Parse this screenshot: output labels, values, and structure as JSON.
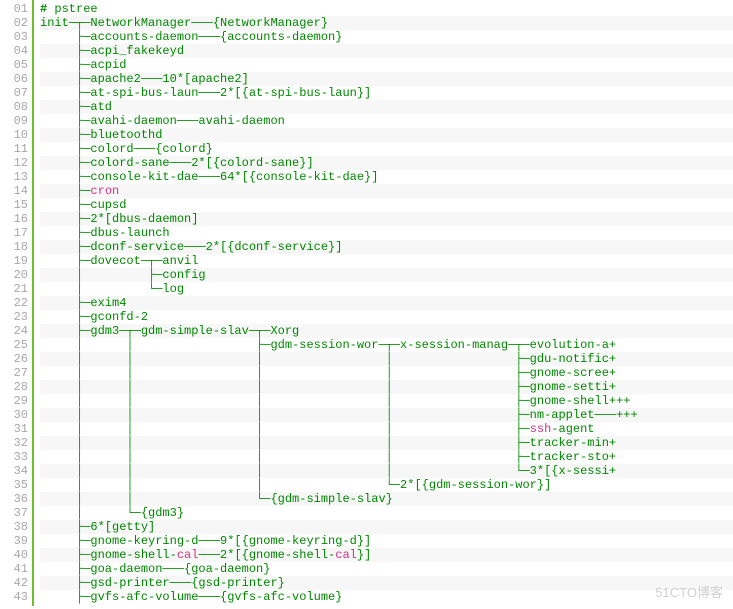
{
  "watermark": "51CTO博客",
  "lines": [
    {
      "n": "01",
      "t": "<span class='prompt'>#</span> pstree"
    },
    {
      "n": "02",
      "t": "init─┬─NetworkManager───{NetworkManager}"
    },
    {
      "n": "03",
      "t": "     ├─accounts-daemon───{accounts-daemon}"
    },
    {
      "n": "04",
      "t": "     ├─acpi_fakekeyd"
    },
    {
      "n": "05",
      "t": "     ├─acpid"
    },
    {
      "n": "06",
      "t": "     ├─apache2───10*[apache2]"
    },
    {
      "n": "07",
      "t": "     ├─at-spi-bus-laun───2*[{at-spi-bus-laun}]"
    },
    {
      "n": "08",
      "t": "     ├─atd"
    },
    {
      "n": "09",
      "t": "     ├─avahi-daemon───avahi-daemon"
    },
    {
      "n": "10",
      "t": "     ├─bluetoothd"
    },
    {
      "n": "11",
      "t": "     ├─colord───{colord}"
    },
    {
      "n": "12",
      "t": "     ├─colord-sane───2*[{colord-sane}]"
    },
    {
      "n": "13",
      "t": "     ├─console-kit-dae───64*[{console-kit-dae}]"
    },
    {
      "n": "14",
      "t": "     ├─<span class='hl'>cron</span>"
    },
    {
      "n": "15",
      "t": "     ├─cupsd"
    },
    {
      "n": "16",
      "t": "     ├─2*[dbus-daemon]"
    },
    {
      "n": "17",
      "t": "     ├─dbus-launch"
    },
    {
      "n": "18",
      "t": "     ├─dconf-service───2*[{dconf-service}]"
    },
    {
      "n": "19",
      "t": "     ├─dovecot─┬─anvil"
    },
    {
      "n": "20",
      "t": "     │         ├─config"
    },
    {
      "n": "21",
      "t": "     │         └─log"
    },
    {
      "n": "22",
      "t": "     ├─exim4"
    },
    {
      "n": "23",
      "t": "     ├─gconfd-2"
    },
    {
      "n": "24",
      "t": "     ├─gdm3─┬─gdm-simple-slav─┬─Xorg"
    },
    {
      "n": "25",
      "t": "     │      │                 ├─gdm-session-wor─┬─x-session-manag─┬─evolution-a+"
    },
    {
      "n": "26",
      "t": "     │      │                 │                 │                 ├─gdu-notific+"
    },
    {
      "n": "27",
      "t": "     │      │                 │                 │                 ├─gnome-scree+"
    },
    {
      "n": "28",
      "t": "     │      │                 │                 │                 ├─gnome-setti+"
    },
    {
      "n": "29",
      "t": "     │      │                 │                 │                 ├─gnome-shell+++"
    },
    {
      "n": "30",
      "t": "     │      │                 │                 │                 ├─nm-applet───+++"
    },
    {
      "n": "31",
      "t": "     │      │                 │                 │                 ├─<span class='hl'>ssh</span>-agent"
    },
    {
      "n": "32",
      "t": "     │      │                 │                 │                 ├─tracker-min+"
    },
    {
      "n": "33",
      "t": "     │      │                 │                 │                 ├─tracker-sto+"
    },
    {
      "n": "34",
      "t": "     │      │                 │                 │                 └─3*[{x-sessi+"
    },
    {
      "n": "35",
      "t": "     │      │                 │                 └─2*[{gdm-session-wor}]"
    },
    {
      "n": "36",
      "t": "     │      │                 └─{gdm-simple-slav}"
    },
    {
      "n": "37",
      "t": "     │      └─{gdm3}"
    },
    {
      "n": "38",
      "t": "     ├─6*[getty]"
    },
    {
      "n": "39",
      "t": "     ├─gnome-keyring-d───9*[{gnome-keyring-d}]"
    },
    {
      "n": "40",
      "t": "     ├─gnome-shell-<span class='hl'>cal</span>───2*[{gnome-shell-<span class='hl'>cal</span>}]"
    },
    {
      "n": "41",
      "t": "     ├─goa-daemon───{goa-daemon}"
    },
    {
      "n": "42",
      "t": "     ├─gsd-printer───{gsd-printer}"
    },
    {
      "n": "43",
      "t": "     ├─gvfs-afc-volume───{gvfs-afc-volume}"
    }
  ]
}
